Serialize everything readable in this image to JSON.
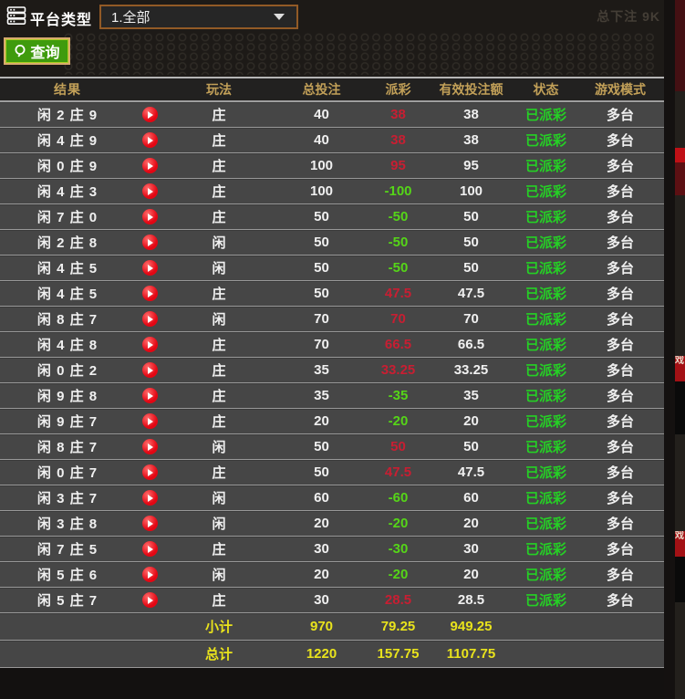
{
  "filters": {
    "platform_label": "平台类型",
    "platform_value": "1.全部",
    "query_label": "查询"
  },
  "background": {
    "faint_text": "总下注 9K",
    "edge_text": "戏"
  },
  "table": {
    "columns": [
      {
        "key": "result",
        "label": "结果"
      },
      {
        "key": "play",
        "label": ""
      },
      {
        "key": "method",
        "label": "玩法"
      },
      {
        "key": "bet",
        "label": "总投注"
      },
      {
        "key": "payout",
        "label": "派彩"
      },
      {
        "key": "valid",
        "label": "有效投注额"
      },
      {
        "key": "status",
        "label": "状态"
      },
      {
        "key": "mode",
        "label": "游戏模式"
      }
    ],
    "rows": [
      {
        "result": "闲 2 庄 9",
        "method": "庄",
        "bet": "40",
        "payout": "38",
        "valid": "38",
        "status": "已派彩",
        "mode": "多台"
      },
      {
        "result": "闲 4 庄 9",
        "method": "庄",
        "bet": "40",
        "payout": "38",
        "valid": "38",
        "status": "已派彩",
        "mode": "多台"
      },
      {
        "result": "闲 0 庄 9",
        "method": "庄",
        "bet": "100",
        "payout": "95",
        "valid": "95",
        "status": "已派彩",
        "mode": "多台"
      },
      {
        "result": "闲 4 庄 3",
        "method": "庄",
        "bet": "100",
        "payout": "-100",
        "valid": "100",
        "status": "已派彩",
        "mode": "多台"
      },
      {
        "result": "闲 7 庄 0",
        "method": "庄",
        "bet": "50",
        "payout": "-50",
        "valid": "50",
        "status": "已派彩",
        "mode": "多台"
      },
      {
        "result": "闲 2 庄 8",
        "method": "闲",
        "bet": "50",
        "payout": "-50",
        "valid": "50",
        "status": "已派彩",
        "mode": "多台"
      },
      {
        "result": "闲 4 庄 5",
        "method": "闲",
        "bet": "50",
        "payout": "-50",
        "valid": "50",
        "status": "已派彩",
        "mode": "多台"
      },
      {
        "result": "闲 4 庄 5",
        "method": "庄",
        "bet": "50",
        "payout": "47.5",
        "valid": "47.5",
        "status": "已派彩",
        "mode": "多台"
      },
      {
        "result": "闲 8 庄 7",
        "method": "闲",
        "bet": "70",
        "payout": "70",
        "valid": "70",
        "status": "已派彩",
        "mode": "多台"
      },
      {
        "result": "闲 4 庄 8",
        "method": "庄",
        "bet": "70",
        "payout": "66.5",
        "valid": "66.5",
        "status": "已派彩",
        "mode": "多台"
      },
      {
        "result": "闲 0 庄 2",
        "method": "庄",
        "bet": "35",
        "payout": "33.25",
        "valid": "33.25",
        "status": "已派彩",
        "mode": "多台"
      },
      {
        "result": "闲 9 庄 8",
        "method": "庄",
        "bet": "35",
        "payout": "-35",
        "valid": "35",
        "status": "已派彩",
        "mode": "多台"
      },
      {
        "result": "闲 9 庄 7",
        "method": "庄",
        "bet": "20",
        "payout": "-20",
        "valid": "20",
        "status": "已派彩",
        "mode": "多台"
      },
      {
        "result": "闲 8 庄 7",
        "method": "闲",
        "bet": "50",
        "payout": "50",
        "valid": "50",
        "status": "已派彩",
        "mode": "多台"
      },
      {
        "result": "闲 0 庄 7",
        "method": "庄",
        "bet": "50",
        "payout": "47.5",
        "valid": "47.5",
        "status": "已派彩",
        "mode": "多台"
      },
      {
        "result": "闲 3 庄 7",
        "method": "闲",
        "bet": "60",
        "payout": "-60",
        "valid": "60",
        "status": "已派彩",
        "mode": "多台"
      },
      {
        "result": "闲 3 庄 8",
        "method": "闲",
        "bet": "20",
        "payout": "-20",
        "valid": "20",
        "status": "已派彩",
        "mode": "多台"
      },
      {
        "result": "闲 7 庄 5",
        "method": "庄",
        "bet": "30",
        "payout": "-30",
        "valid": "30",
        "status": "已派彩",
        "mode": "多台"
      },
      {
        "result": "闲 5 庄 6",
        "method": "闲",
        "bet": "20",
        "payout": "-20",
        "valid": "20",
        "status": "已派彩",
        "mode": "多台"
      },
      {
        "result": "闲 5 庄 7",
        "method": "庄",
        "bet": "30",
        "payout": "28.5",
        "valid": "28.5",
        "status": "已派彩",
        "mode": "多台"
      }
    ],
    "subtotal": {
      "label": "小计",
      "bet": "970",
      "payout": "79.25",
      "valid": "949.25"
    },
    "total": {
      "label": "总计",
      "bet": "1220",
      "payout": "157.75",
      "valid": "1107.75"
    }
  },
  "colors": {
    "header_text": "#c2a058",
    "row_bg": "#464646",
    "payout_win_red": "#c81e32",
    "payout_loss_green": "#55d518",
    "status_green": "#25d025",
    "totals_yellow": "#e9e31c",
    "query_button_green": "#3f9b0e",
    "dropdown_border_orange": "#925a26",
    "play_icon_red": "#e30613"
  }
}
